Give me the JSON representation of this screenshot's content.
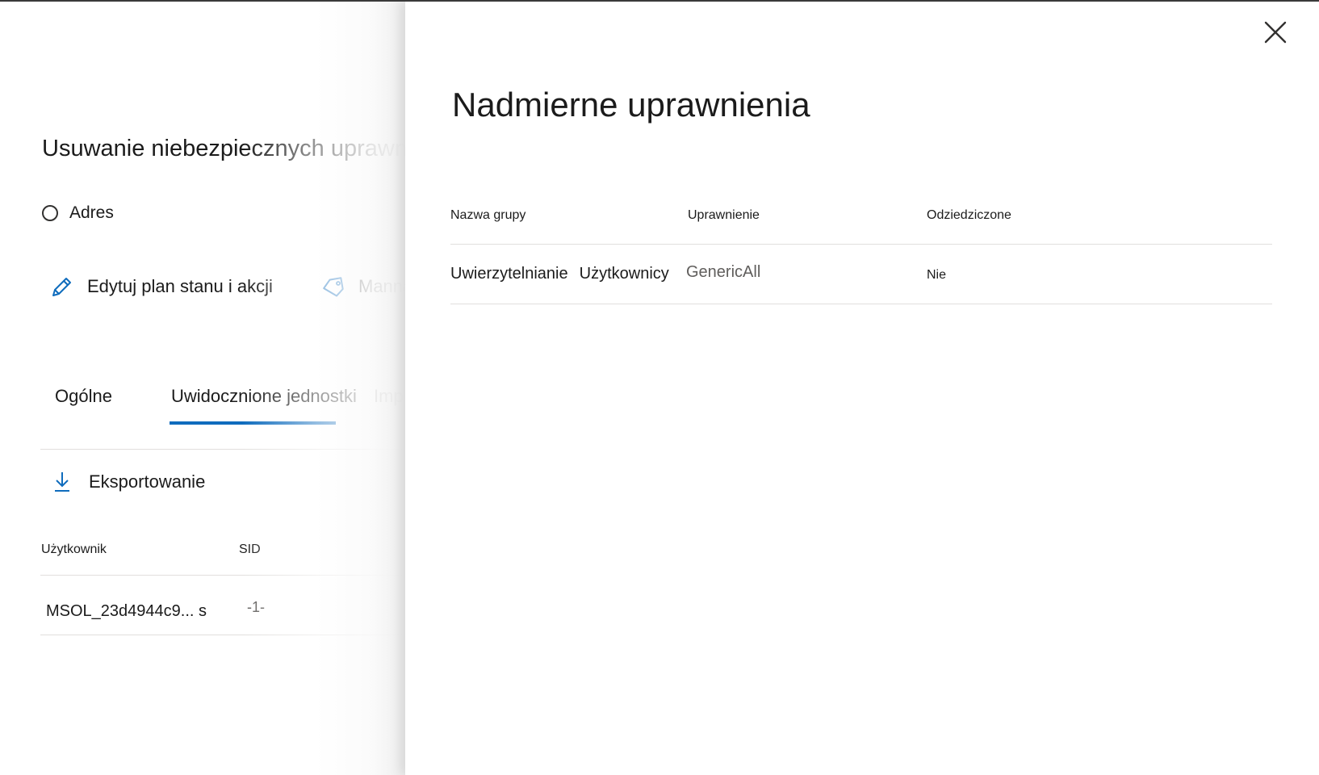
{
  "background_page": {
    "title": "Usuwanie niebezpiecznych uprawnień",
    "radio_label": "Adres",
    "commands": {
      "edit": "Edytuj plan stanu i akcji",
      "manage": "Manna",
      "export": "Eksportowanie"
    },
    "tabs": [
      {
        "label": "Ogólne",
        "selected": false
      },
      {
        "label": "Uwidocznione jednostki",
        "selected": true
      },
      {
        "label": "Imp",
        "selected": false
      }
    ],
    "table": {
      "headers": [
        "Użytkownik",
        "SID"
      ],
      "rows": [
        {
          "user": "MSOL_23d4944c9... s",
          "sid": "-1-"
        }
      ]
    }
  },
  "panel": {
    "title": "Nadmierne uprawnienia",
    "close_icon": "close-icon",
    "table": {
      "headers": [
        "Nazwa grupy",
        "Uprawnienie",
        "Odziedziczone"
      ],
      "rows": [
        {
          "group_part1": "Uwierzytelnianie",
          "group_part2": "Użytkownicy",
          "permission": "GenericAll",
          "inherited": "Nie"
        }
      ]
    }
  },
  "colors": {
    "accent": "#0f6cbd",
    "text": "#1b1b1b",
    "muted": "#605e5c",
    "divider": "#e1dfdd"
  }
}
